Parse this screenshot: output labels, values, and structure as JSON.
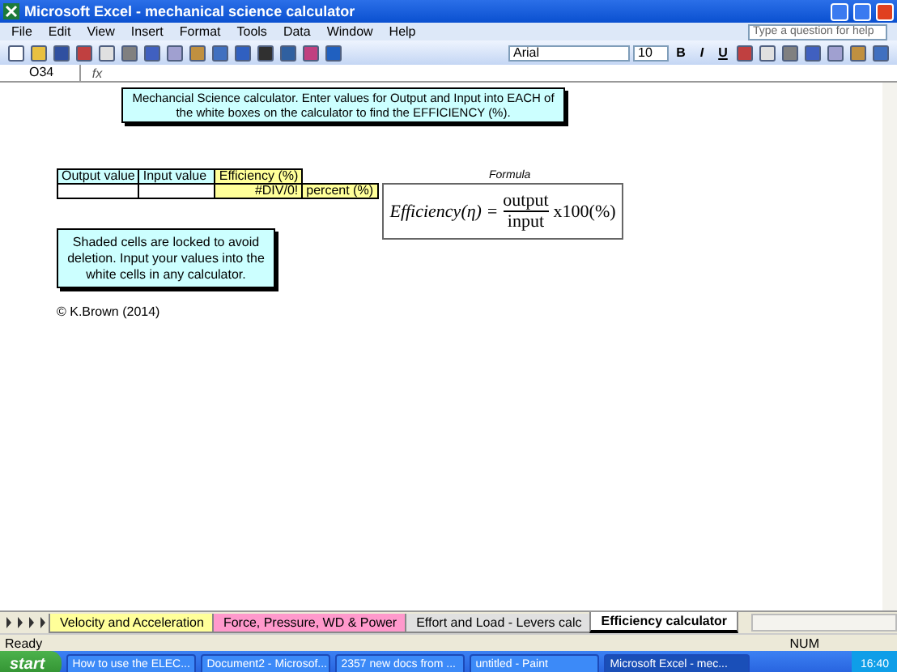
{
  "window": {
    "title": "Microsoft Excel - mechanical science calculator"
  },
  "menu": [
    "File",
    "Edit",
    "View",
    "Insert",
    "Format",
    "Tools",
    "Data",
    "Window",
    "Help"
  ],
  "help_box": {
    "placeholder": "Type a question for help"
  },
  "toolbar": {
    "font": "Arial",
    "size": "10",
    "format_buttons": [
      "B",
      "I",
      "U"
    ]
  },
  "formula_bar": {
    "name_box": "O34",
    "fx": "fx"
  },
  "sheet": {
    "instruction": "Mechancial Science calculator.  Enter values for Output and Input into EACH of the white boxes on the calculator to find the EFFICIENCY (%).",
    "table": {
      "columns": [
        "Output value",
        "Input value",
        "Efficiency (%)"
      ],
      "result": "#DIV/0!",
      "unit": "percent (%)"
    },
    "note": "Shaded cells are locked to avoid deletion.  Input your values into the white cells in any calculator.",
    "copyright": "© K.Brown (2014)",
    "formula": {
      "caption": "Formula",
      "lhs": "Efficiency(η) =",
      "numerator": "output",
      "denominator": "input",
      "rhs": "x100(%)"
    }
  },
  "sheet_tabs": [
    {
      "label": "Velocity and Acceleration",
      "color": "#ffff99",
      "selected": false
    },
    {
      "label": "Force, Pressure, WD & Power",
      "color": "#ff99cc",
      "selected": false
    },
    {
      "label": "Effort and Load - Levers calc",
      "color": "#e0e0e0",
      "selected": false
    },
    {
      "label": "Efficiency calculator",
      "color": "#ffffff",
      "selected": true
    }
  ],
  "status_bar": {
    "status": "Ready",
    "num": "NUM"
  },
  "taskbar": {
    "start": "start",
    "tasks": [
      {
        "label": "How to use the ELEC...",
        "selected": false
      },
      {
        "label": "Document2 - Microsof...",
        "selected": false
      },
      {
        "label": "2357 new docs from ...",
        "selected": false
      },
      {
        "label": "untitled - Paint",
        "selected": false
      },
      {
        "label": "Microsoft Excel - mec...",
        "selected": true
      }
    ],
    "clock": "16:40"
  }
}
